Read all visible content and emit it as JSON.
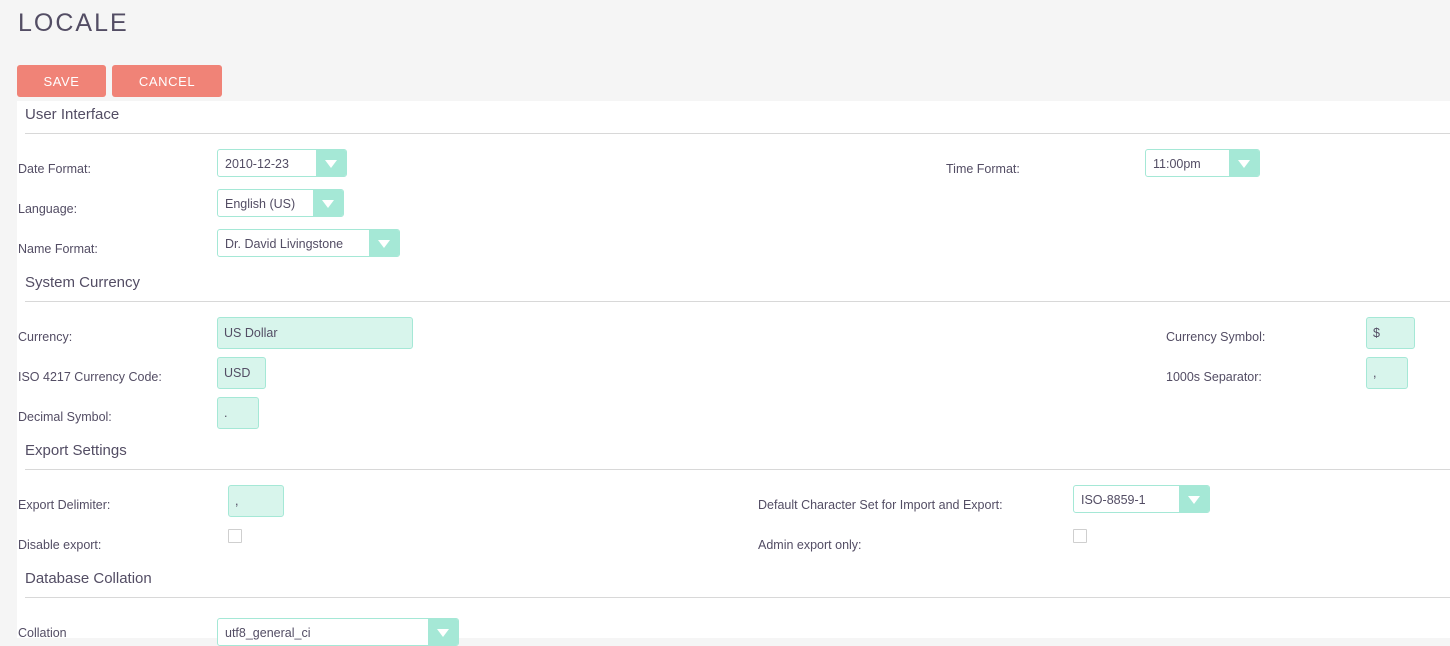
{
  "page": {
    "title": "LOCALE"
  },
  "toolbar": {
    "save_label": "SAVE",
    "cancel_label": "CANCEL"
  },
  "colors": {
    "button": "#f08377",
    "field_border": "#a5e8d6",
    "field_fill": "#d8f5ec",
    "text": "#534d64"
  },
  "user_interface": {
    "title": "User Interface",
    "date_format_label": "Date Format:",
    "date_format_value": "2010-12-23",
    "time_format_label": "Time Format:",
    "time_format_value": "11:00pm",
    "language_label": "Language:",
    "language_value": "English (US)",
    "name_format_label": "Name Format:",
    "name_format_value": "Dr. David Livingstone"
  },
  "system_currency": {
    "title": "System Currency",
    "currency_label": "Currency:",
    "currency_value": "US Dollar",
    "currency_symbol_label": "Currency Symbol:",
    "currency_symbol_value": "$",
    "iso_code_label": "ISO 4217 Currency Code:",
    "iso_code_value": "USD",
    "thousands_separator_label": "1000s Separator:",
    "thousands_separator_value": ",",
    "decimal_symbol_label": "Decimal Symbol:",
    "decimal_symbol_value": "."
  },
  "export_settings": {
    "title": "Export Settings",
    "export_delimiter_label": "Export Delimiter:",
    "export_delimiter_value": ",",
    "charset_label": "Default Character Set for Import and Export:",
    "charset_value": "ISO-8859-1",
    "disable_export_label": "Disable export:",
    "disable_export_checked": false,
    "admin_export_only_label": "Admin export only:",
    "admin_export_only_checked": false
  },
  "database_collation": {
    "title": "Database Collation",
    "collation_label": "Collation",
    "collation_value": "utf8_general_ci"
  }
}
